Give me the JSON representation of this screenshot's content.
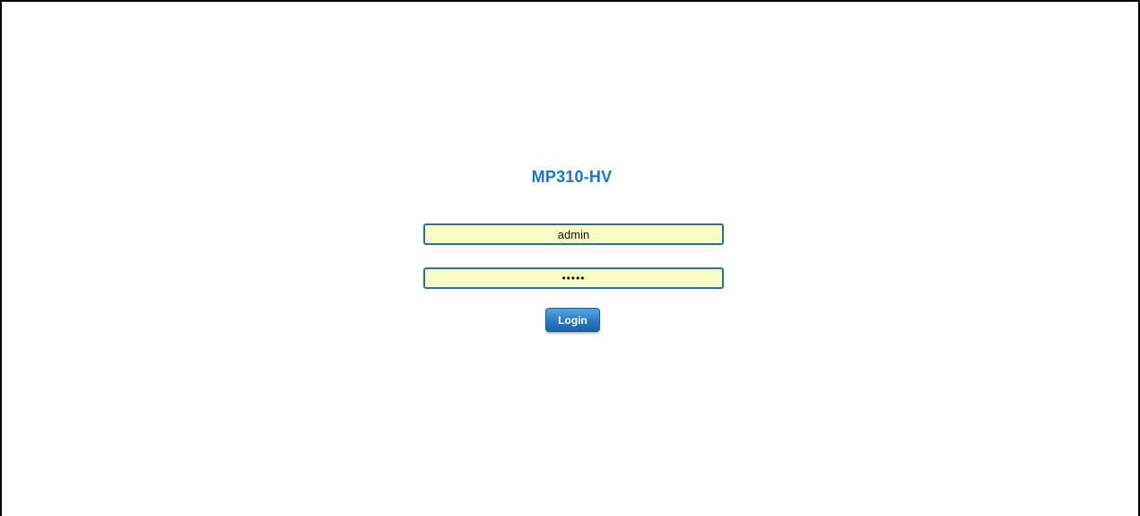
{
  "page": {
    "title": "MP310-HV"
  },
  "login_form": {
    "username_value": "admin",
    "password_value": "•••••",
    "login_label": "Login"
  },
  "colors": {
    "title": "#1a78c2",
    "field_background": "#fafbc5",
    "field_border": "#2a6f9e",
    "button": "#2a79c0"
  }
}
